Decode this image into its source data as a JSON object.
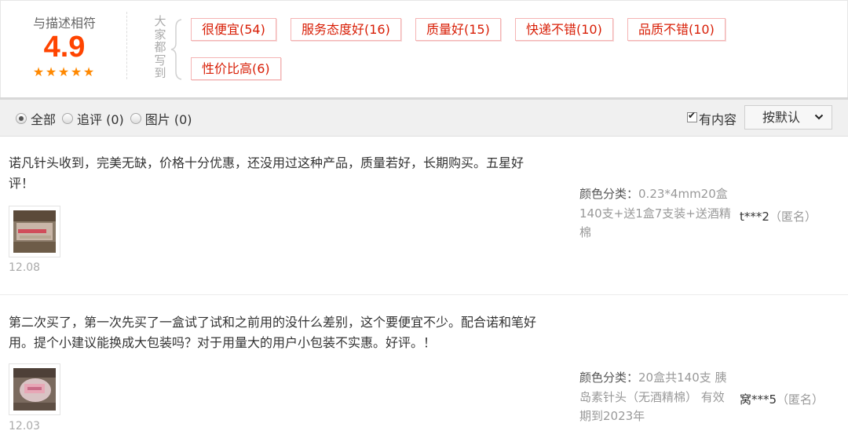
{
  "summary": {
    "score_title": "与描述相符",
    "score": "4.9",
    "star_count": 5,
    "everyone_wrote": [
      "大",
      "家",
      "都",
      "写",
      "到"
    ],
    "tags": [
      "很便宜(54)",
      "服务态度好(16)",
      "质量好(15)",
      "快递不错(10)",
      "品质不错(10)",
      "性价比高(6)"
    ]
  },
  "filter": {
    "options": [
      "全部",
      "追评 (0)",
      "图片 (0)"
    ],
    "selected": "全部",
    "has_content_label": "有内容",
    "has_content_checked": true,
    "sort_label": "按默认"
  },
  "reviews": [
    {
      "text": "诺凡针头收到，完美无缺，价格十分优惠，还没用过这种产品，质量若好，长期购买。五星好评！",
      "date": "12.08",
      "sku_label": "颜色分类：",
      "sku_value": "0.23*4mm20盒140支+送1盒7支装+送酒精棉",
      "user": "t***2",
      "anon": "（匿名）"
    },
    {
      "text": "第二次买了，第一次先买了一盒试了试和之前用的没什么差别，这个要便宜不少。配合诺和笔好用。提个小建议能换成大包装吗？对于用量大的用户小包装不实惠。好评。！",
      "date": "12.03",
      "sku_label": "颜色分类：",
      "sku_value": "20盒共140支 胰岛素针头（无酒精棉） 有效期到2023年",
      "user": "窝***5",
      "anon": "（匿名）"
    }
  ],
  "colors": {
    "score": "#ff4400",
    "star": "#ff8800",
    "tag_text": "#d81e06",
    "tag_border": "#f5b4b4"
  }
}
